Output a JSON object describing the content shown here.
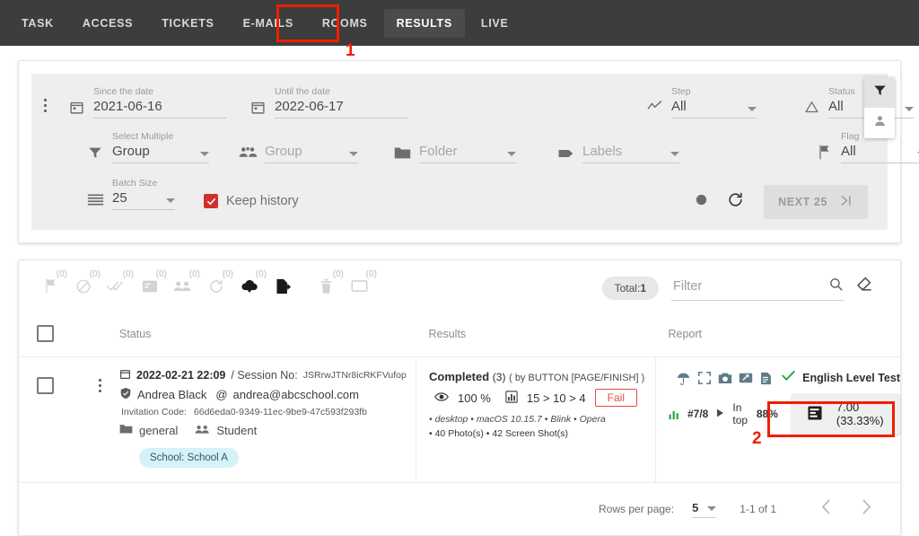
{
  "nav": {
    "tabs": [
      {
        "label": "TASK",
        "active": false
      },
      {
        "label": "ACCESS",
        "active": false
      },
      {
        "label": "TICKETS",
        "active": false
      },
      {
        "label": "E-MAILS",
        "active": false
      },
      {
        "label": "ROOMS",
        "active": false
      },
      {
        "label": "RESULTS",
        "active": true
      },
      {
        "label": "LIVE",
        "active": false
      }
    ]
  },
  "annotations": [
    {
      "number": "1",
      "target": "results-tab"
    },
    {
      "number": "2",
      "target": "report-score-button"
    }
  ],
  "filters": {
    "since": {
      "label": "Since the date",
      "value": "2021-06-16",
      "icon": "calendar-icon"
    },
    "until": {
      "label": "Until the date",
      "value": "2022-06-17",
      "icon": "calendar-icon"
    },
    "step": {
      "label": "Step",
      "value": "All",
      "icon": "trend-line-icon"
    },
    "status": {
      "label": "Status",
      "value": "All",
      "icon": "triangle-icon"
    },
    "select_multiple": {
      "label": "Select Multiple",
      "value": "Group",
      "icon": "funnel-icon"
    },
    "group": {
      "label": "",
      "placeholder": "Group",
      "icon": "people-icon"
    },
    "folder": {
      "label": "",
      "placeholder": "Folder",
      "icon": "folder-icon"
    },
    "labels": {
      "label": "",
      "placeholder": "Labels",
      "icon": "tag-icon"
    },
    "flag": {
      "label": "Flag",
      "value": "All",
      "icon": "flag-icon"
    },
    "batch_size": {
      "label": "Batch Size",
      "value": "25",
      "icon": "list-lines-icon"
    },
    "keep_history": {
      "label": "Keep history",
      "checked": true,
      "color": "#d32f2f"
    },
    "next_button": {
      "label": "NEXT 25",
      "icon": "skip-next-icon"
    },
    "record_icon": "record-dot-icon",
    "refresh_icon": "refresh-icon",
    "side_buttons": [
      {
        "icon": "funnel-icon",
        "selected": true
      },
      {
        "icon": "person-icon",
        "selected": false
      }
    ]
  },
  "results_toolbar": {
    "actions": [
      {
        "icon": "flag-icon",
        "count": "(0)"
      },
      {
        "icon": "block-icon",
        "count": "(0)"
      },
      {
        "icon": "double-check-icon",
        "count": "(0)"
      },
      {
        "icon": "note-icon",
        "count": "(0)"
      },
      {
        "icon": "people-icon",
        "count": "(0)"
      },
      {
        "icon": "refresh-icon",
        "count": "(0)"
      },
      {
        "icon": "cloud-download-icon",
        "count": "(0)"
      },
      {
        "icon": "file-export-icon",
        "count": ""
      },
      {
        "icon": "trash-icon",
        "count": "(0)"
      },
      {
        "icon": "monitor-icon",
        "count": "(0)"
      }
    ],
    "total_label": "Total:",
    "total_value": "1",
    "filter_placeholder": "Filter",
    "filter_value": "",
    "search_icon": "search-icon",
    "eraser_icon": "eraser-icon"
  },
  "table": {
    "columns": [
      "Status",
      "Results",
      "Report"
    ],
    "row": {
      "date": "2022-02-21 22:09",
      "session_label": "/ Session No:",
      "session_no": "JSRrwJTNr8icRKFVufop",
      "user_name": "Andrea Black",
      "at_symbol": "@",
      "email": "andrea@abcschool.com",
      "invitation_label": "Invitation Code:",
      "invitation_code": "66d6eda0-9349-11ec-9be9-47c593f293fb",
      "folder": "general",
      "role": "Student",
      "chip": "School: School A",
      "results": {
        "state": "Completed",
        "count": "(3)",
        "by": "( by BUTTON [PAGE/FINISH] )",
        "percent": "100 %",
        "progression": "15  >  10  >  4",
        "verdict": "Fail",
        "meta_line1": "• desktop    • macOS 10.15.7    • Blink    • Opera",
        "meta_line2": "• 40 Photo(s)  • 42 Screen Shot(s)"
      },
      "report": {
        "icons": [
          "umbrella-icon",
          "fullscreen-icon",
          "camera-icon",
          "share-icon",
          "document-icon"
        ],
        "check_icon": "check-icon",
        "title": "English Level Test",
        "rank": "#7/8",
        "top_label": "In top",
        "top_value": "88%",
        "score": "7.00 (33.33%)",
        "score_icon": "report-bars-icon",
        "bars_icon": "bar-chart-icon"
      }
    }
  },
  "pager": {
    "rows_label": "Rows per page:",
    "rows_value": "5",
    "range": "1-1 of 1",
    "prev_icon": "chevron-left-icon",
    "next_icon": "chevron-right-icon"
  }
}
